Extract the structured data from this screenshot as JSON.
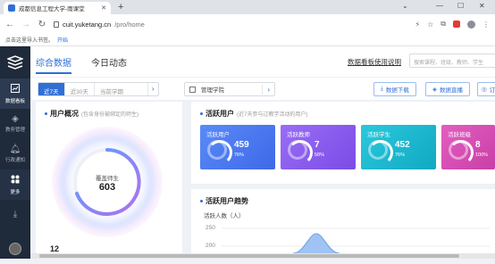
{
  "browser": {
    "tab_title": "成都信息工程大学-雨课堂",
    "url_host": "cuit.yuketang.cn",
    "url_path": "/pro/home",
    "bookmark_hint": "点击这里导入书签。",
    "bookmark_link": "开始"
  },
  "sidebar": {
    "items": [
      {
        "label": "数据看板",
        "icon": "chart-icon"
      },
      {
        "label": "教务管理",
        "icon": "layers-icon"
      },
      {
        "label": "行政通知",
        "icon": "bell-icon"
      },
      {
        "label": "更多",
        "icon": "grid-icon"
      }
    ]
  },
  "header": {
    "tabs": [
      "综合数据",
      "今日动态"
    ],
    "guide_link": "数据看板使用说明",
    "search_placeholder": "搜索课程、班级、教师、学生"
  },
  "filters": {
    "ranges": [
      "近7天",
      "近30天",
      "当前学期"
    ],
    "college": "管理学院",
    "buttons": [
      "数据下载",
      "数据直播",
      "订"
    ]
  },
  "user_overview": {
    "title": "用户概况",
    "subtitle": "(包含身份被绑定的师生)",
    "center_label": "覆盖师生",
    "center_value": "603",
    "bottom_value": "12"
  },
  "active_users": {
    "title": "活跃用户",
    "subtitle": "(近7天参与过教学活动的用户)",
    "stats": [
      {
        "label": "活跃用户",
        "value": "459",
        "pct": "76%",
        "color": "#4f7cf5"
      },
      {
        "label": "活跃教师",
        "value": "7",
        "pct": "58%",
        "color": "#8a5cf0"
      },
      {
        "label": "活跃学生",
        "value": "452",
        "pct": "76%",
        "color": "#19b8d0"
      },
      {
        "label": "活跃班级",
        "value": "8",
        "pct": "100%",
        "color": "#d94fb5"
      }
    ]
  },
  "trend": {
    "title": "活跃用户趋势",
    "ylabel": "活跃人数（人）",
    "yticks": [
      "250",
      "200"
    ]
  },
  "colors": {
    "accent": "#2f6fd6",
    "sidebar_bg": "#1f2a3a"
  }
}
